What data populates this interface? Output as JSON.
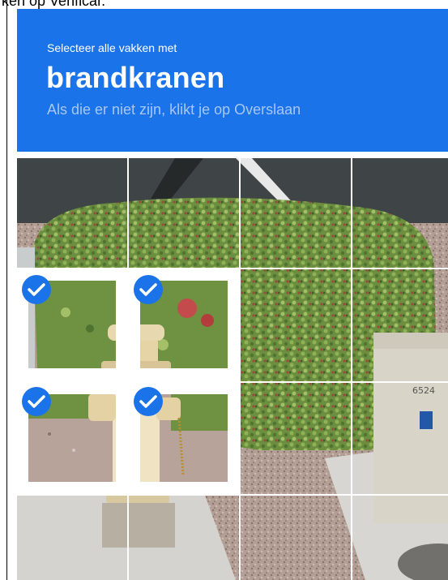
{
  "partial_top_text": "ken op Verificar.",
  "header": {
    "instruction": "Selecteer alle vakken met",
    "target": "brandkranen",
    "hint": "Als die er niet zijn, klikt je op Overslaan"
  },
  "grid": {
    "rows": 4,
    "cols": 4,
    "tiles": [
      {
        "row": 0,
        "col": 0,
        "selected": false
      },
      {
        "row": 0,
        "col": 1,
        "selected": false
      },
      {
        "row": 0,
        "col": 2,
        "selected": false
      },
      {
        "row": 0,
        "col": 3,
        "selected": false
      },
      {
        "row": 1,
        "col": 0,
        "selected": true
      },
      {
        "row": 1,
        "col": 1,
        "selected": true
      },
      {
        "row": 1,
        "col": 2,
        "selected": false
      },
      {
        "row": 1,
        "col": 3,
        "selected": false
      },
      {
        "row": 2,
        "col": 0,
        "selected": true
      },
      {
        "row": 2,
        "col": 1,
        "selected": true
      },
      {
        "row": 2,
        "col": 2,
        "selected": false
      },
      {
        "row": 2,
        "col": 3,
        "selected": false
      },
      {
        "row": 3,
        "col": 0,
        "selected": false
      },
      {
        "row": 3,
        "col": 1,
        "selected": false
      },
      {
        "row": 3,
        "col": 2,
        "selected": false
      },
      {
        "row": 3,
        "col": 3,
        "selected": false
      }
    ]
  },
  "photo_subject": "fire-hydrant-street-photo",
  "utility_box_label": "6524",
  "colors": {
    "header_bg": "#1a73e8",
    "check_bg": "#1a73e8"
  }
}
